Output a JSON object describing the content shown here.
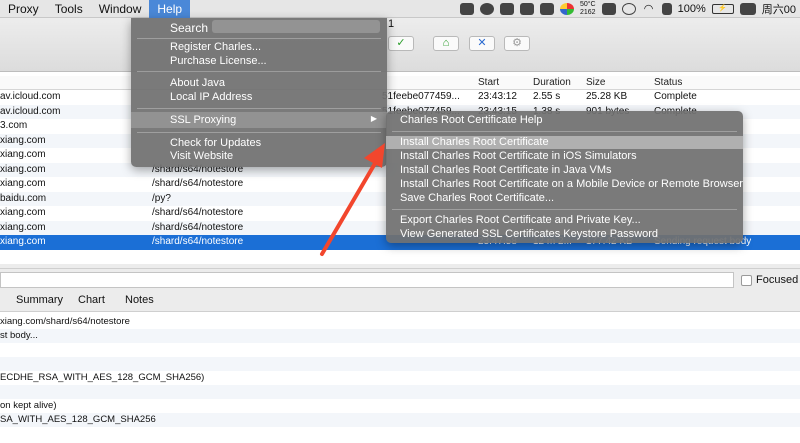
{
  "menubar": {
    "items": [
      "Proxy",
      "Tools",
      "Window",
      "Help"
    ],
    "cpu_temp": "50°C",
    "cpu_rpm": "2162",
    "battery": "100%",
    "clock": "周六00"
  },
  "toolbar": {
    "title_fragment": "1"
  },
  "table": {
    "headers": {
      "start": "Start",
      "duration": "Duration",
      "size": "Size",
      "status": "Status"
    },
    "rows": [
      {
        "host": "av.icloud.com",
        "path": "",
        "path2": "51feebe077459...",
        "start": "23:43:12",
        "duration": "2.55 s",
        "size": "25.28 KB",
        "status": "Complete"
      },
      {
        "host": "av.icloud.com",
        "path": "",
        "path2": "51feebe077459...",
        "start": "23:43:15",
        "duration": "1.38 s",
        "size": "901 bytes",
        "status": "Complete"
      },
      {
        "host": "3.com",
        "path": "",
        "path2": "",
        "start": "",
        "duration": "",
        "size": "",
        "status": ""
      },
      {
        "host": "xiang.com",
        "path": "",
        "path2": "",
        "start": "",
        "duration": "",
        "size": "",
        "status": ""
      },
      {
        "host": "xiang.com",
        "path": "",
        "path2": "",
        "start": "",
        "duration": "",
        "size": "",
        "status": ""
      },
      {
        "host": "xiang.com",
        "path": "/shard/s64/notestore",
        "path2": "",
        "start": "",
        "duration": "",
        "size": "",
        "status": ""
      },
      {
        "host": "xiang.com",
        "path": "/shard/s64/notestore",
        "path2": "",
        "start": "",
        "duration": "",
        "size": "",
        "status": ""
      },
      {
        "host": "baidu.com",
        "path": "/py?",
        "path2": "",
        "start": "",
        "duration": "",
        "size": "",
        "status": ""
      },
      {
        "host": "xiang.com",
        "path": "/shard/s64/notestore",
        "path2": "",
        "start": "",
        "duration": "",
        "size": "",
        "status": ""
      },
      {
        "host": "xiang.com",
        "path": "/shard/s64/notestore",
        "path2": "",
        "start": "",
        "duration": "",
        "size": "",
        "status": ""
      },
      {
        "host": "xiang.com",
        "path": "/shard/s64/notestore",
        "path2": "",
        "start": "23:47:58",
        "duration": "12 m 2...",
        "size": "177.42 KB",
        "status": "Sending request body"
      }
    ]
  },
  "filterbar": {
    "focused_label": "Focused"
  },
  "tabs": [
    "Summary",
    "Chart",
    "Notes"
  ],
  "detail": {
    "lines": [
      "xiang.com/shard/s64/notestore",
      "st body...",
      "",
      "",
      "ECDHE_RSA_WITH_AES_128_GCM_SHA256)",
      "",
      "on kept alive)",
      "SA_WITH_AES_128_GCM_SHA256",
      ""
    ]
  },
  "help_menu": {
    "search_label": "Search",
    "items": {
      "register": "Register Charles...",
      "purchase": "Purchase License...",
      "about_java": "About Java",
      "local_ip": "Local IP Address",
      "ssl_proxying": "SSL Proxying",
      "check_updates": "Check for Updates",
      "visit_website": "Visit Website"
    }
  },
  "ssl_submenu": {
    "items": [
      "Charles Root Certificate Help",
      "Install Charles Root Certificate",
      "Install Charles Root Certificate in iOS Simulators",
      "Install Charles Root Certificate in Java VMs",
      "Install Charles Root Certificate on a Mobile Device or Remote Browser",
      "Save Charles Root Certificate...",
      "Export Charles Root Certificate and Private Key...",
      "View Generated SSL Certificates Keystore Password"
    ]
  },
  "colors": {
    "selection": "#1b6fd6",
    "menu_bg": "#707070",
    "annotation_arrow": "#f2462d"
  }
}
